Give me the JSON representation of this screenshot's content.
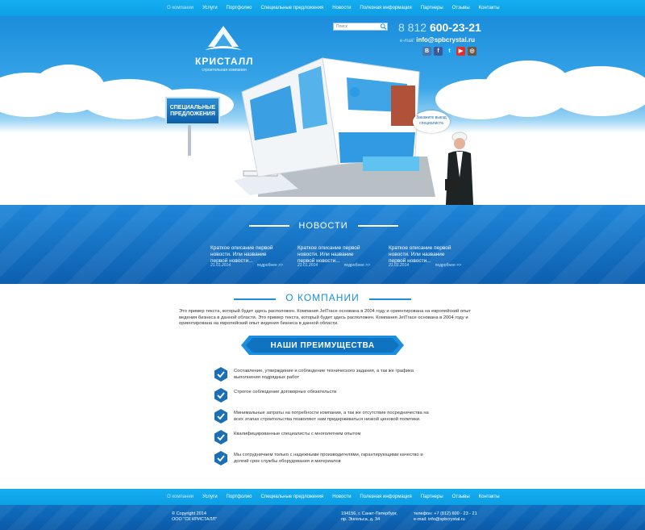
{
  "nav": {
    "items": [
      {
        "label": "О компании",
        "active": true
      },
      {
        "label": "Услуги"
      },
      {
        "label": "Портфолио"
      },
      {
        "label": "Специальные предложения"
      },
      {
        "label": "Новости"
      },
      {
        "label": "Полезная информация"
      },
      {
        "label": "Партнеры"
      },
      {
        "label": "Отзывы"
      },
      {
        "label": "Контакты"
      }
    ]
  },
  "header": {
    "logo_name": "КРИСТАЛЛ",
    "logo_sub": "строительная компания",
    "search_placeholder": "Поиск",
    "phone_prefix": "8 812",
    "phone_number": "600-23-21",
    "email_label": "e-mail:",
    "email": "info@spbcrystal.ru",
    "socials": [
      "vk-icon",
      "facebook-icon",
      "twitter-icon",
      "youtube-icon",
      "instagram-icon"
    ],
    "special_offer": "СПЕЦИАЛЬНЫЕ ПРЕДЛОЖЕНИЯ",
    "callout": "Закажите выезд специалиста"
  },
  "news": {
    "title": "НОВОСТИ",
    "items": [
      {
        "text": "Краткое описание первой новости. Или название первой новости...",
        "date": "21.01.2014",
        "more": "подробнее >>"
      },
      {
        "text": "Краткое описание первой новости. Или название первой новости...",
        "date": "21.01.2014",
        "more": "подробнее >>"
      },
      {
        "text": "Краткое описание первой новости. Или название первой новости...",
        "date": "21.01.2014",
        "more": "подробнее >>"
      }
    ]
  },
  "about": {
    "title": "О КОМПАНИИ",
    "text": "Это пример текста, который будет здесь расположен. Компания JetTrace основана в 2004 году и ориентирована на европейский опыт ведения бизнеса в данной области. Это пример текста, который будет здесь расположен. Компания JetTrace основана в 2004 году и ориентирована на европейский опыт ведения бизнеса в данной области."
  },
  "advantages": {
    "title": "НАШИ ПРЕИМУЩЕСТВА",
    "items": [
      "Составление, утверждение и соблюдение технического задания, а так же графика выполнения подрядных работ",
      "Строгое соблюдение договорных обязательств",
      "Минимальные затраты на потребности компании, а так же отсутствие посредничества на всех этапах строительства позволяют нам придерживаться низкой ценовой политики.",
      "Квалифицированные специалисты с многолетним опытом",
      "Мы сотрудничаем только с надежными производителями, гарантирующими качество и долгий срок службы оборудования и материалов"
    ]
  },
  "footer": {
    "copyright": "© Copyright 2014",
    "company": "ООО \"СК КРИСТАЛЛ\"",
    "address_line1": "194156, г. Санкт-Петербург,",
    "address_line2": "пр. Энгельса, д. 34",
    "phone": "телефон: +7 (812) 600 - 23 - 21",
    "email": "e-mail: info@spbcrystal.ru"
  },
  "colors": {
    "accent": "#1a8fdf",
    "nav": "#14aef1",
    "dark_blue": "#0d5fb0"
  }
}
